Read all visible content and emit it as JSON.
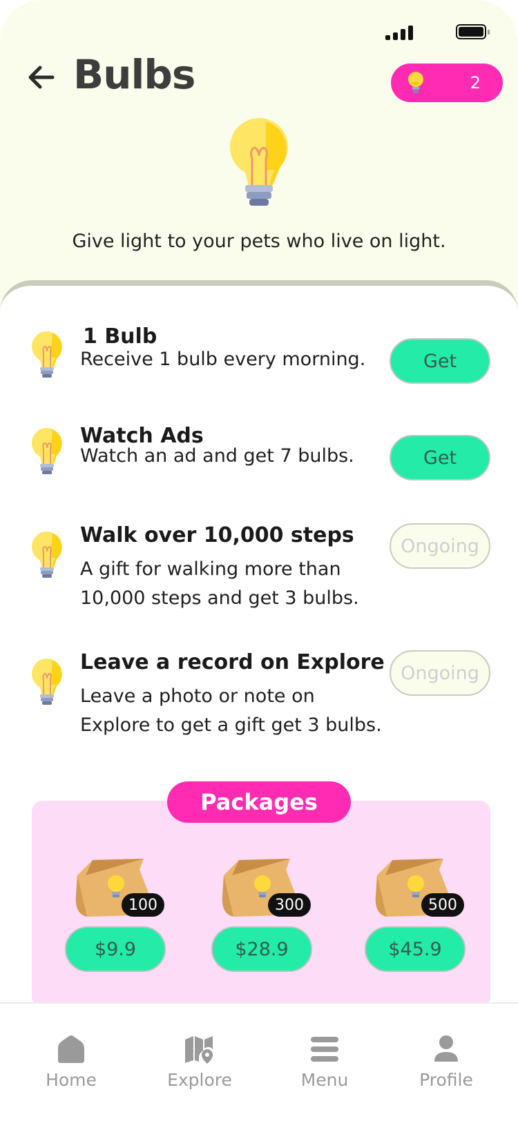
{
  "header": {
    "title": "Bulbs",
    "bulb_count": "2"
  },
  "tagline": "Give light to your pets who live on light.",
  "tasks": [
    {
      "title": "1 Bulb",
      "desc": "Receive 1 bulb every morning.",
      "action": "Get"
    },
    {
      "title": "Watch Ads",
      "desc": "Watch an ad and get 7 bulbs.",
      "action": "Get"
    },
    {
      "title": "Walk over 10,000 steps",
      "desc": "A gift for walking more than 10,000 steps and get 3 bulbs.",
      "action": "Ongoing"
    },
    {
      "title": "Leave a record on Explore",
      "desc": "Leave a photo or note on Explore to get a gift get 3 bulbs.",
      "action": "Ongoing"
    }
  ],
  "packages": {
    "label": "Packages",
    "items": [
      {
        "qty": "100",
        "price": "$9.9"
      },
      {
        "qty": "300",
        "price": "$28.9"
      },
      {
        "qty": "500",
        "price": "$45.9"
      }
    ]
  },
  "nav": {
    "home": "Home",
    "explore": "Explore",
    "menu": "Menu",
    "profile": "Profile"
  },
  "colors": {
    "accent_pink": "#ff2bb3",
    "accent_green": "#22eca8",
    "top_bg": "#fbfdec",
    "package_bg": "#fddcf8"
  },
  "icons": {
    "back": "arrow-left-icon",
    "bulb": "lightbulb-icon",
    "bag": "package-bag-icon"
  }
}
